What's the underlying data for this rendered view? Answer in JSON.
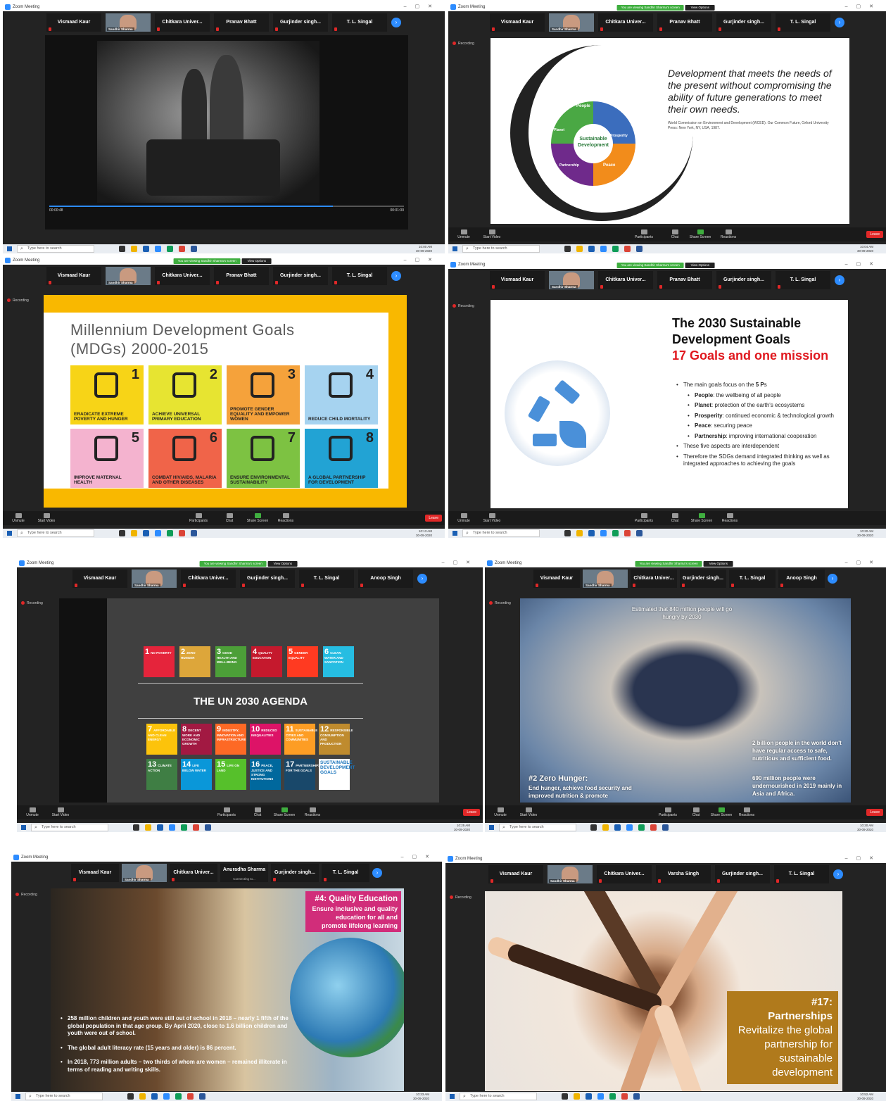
{
  "common": {
    "app_title": "Zoom Meeting",
    "banner": "You are viewing Sandhir Sharma's screen",
    "view_options": "View Options",
    "presenter_caption": "Sandhir Sharma",
    "search_placeholder": "Type here to search",
    "controls": [
      "Unmute",
      "Start Video",
      "Participants",
      "Chat",
      "Share Screen",
      "Reactions"
    ],
    "leave": "Leave",
    "recording": "Recording"
  },
  "panels": [
    {
      "tiles": [
        "Vismaad Kaur",
        "Chitkara Univer...",
        "Pranav Bhatt",
        "Gurjinder singh...",
        "T. L. Singal"
      ],
      "clock_time": "10:00 AM",
      "clock_date": "30-09-2020",
      "video_elapsed": "00:00:48",
      "video_total": "00:01:00"
    },
    {
      "tiles": [
        "Vismaad Kaur",
        "Chitkara Univer...",
        "Pranav Bhatt",
        "Gurjinder singh...",
        "T. L. Singal"
      ],
      "clock_time": "10:04 AM",
      "clock_date": "30-09-2020",
      "participants_count": "49"
    },
    {
      "tiles": [
        "Vismaad Kaur",
        "Chitkara Univer...",
        "Pranav Bhatt",
        "Gurjinder singh...",
        "T. L. Singal"
      ],
      "clock_time": "10:13 AM",
      "clock_date": "30-09-2020",
      "participants_count": "61"
    },
    {
      "tiles": [
        "Vismaad Kaur",
        "Chitkara Univer...",
        "Pranav Bhatt",
        "Gurjinder singh...",
        "T. L. Singal"
      ],
      "clock_time": "10:20 AM",
      "clock_date": "30-09-2020",
      "participants_count": "70"
    },
    {
      "tiles": [
        "Vismaad Kaur",
        "Chitkara Univer...",
        "Gurjinder singh...",
        "T. L. Singal",
        "Anoop Singh"
      ],
      "clock_time": "10:25 AM",
      "clock_date": "30-09-2020",
      "participants_count": "73"
    },
    {
      "tiles": [
        "Vismaad Kaur",
        "Chitkara Univer...",
        "Gurjinder singh...",
        "T. L. Singal",
        "Anoop Singh"
      ],
      "clock_time": "10:30 AM",
      "clock_date": "30-09-2020",
      "participants_count": "74"
    },
    {
      "tiles": [
        "Vismaad Kaur",
        "Chitkara Univer...",
        "Anuradha Sharma",
        "Gurjinder singh...",
        "T. L. Singal"
      ],
      "connecting": "Connecting to...",
      "clock_time": "10:33 AM",
      "clock_date": "30-09-2020"
    },
    {
      "tiles": [
        "Vismaad Kaur",
        "Chitkara Univer...",
        "Varsha Singh",
        "Gurjinder singh...",
        "T. L. Singal"
      ],
      "clock_time": "10:52 AM",
      "clock_date": "30-09-2020"
    }
  ],
  "slide_sd": {
    "quote": "Development that meets the needs of the present without compromising the ability of future generations to meet their own needs.",
    "citation": "World Commission on Environment and Development (WCED). Our Common Future, Oxford University Press: New York, NY, USA, 1987.",
    "core": "Sustainable Development",
    "segments": [
      "People",
      "Prosperity",
      "Peace",
      "Partnership",
      "Planet"
    ]
  },
  "slide_mdg": {
    "title_line1": "Millennium Development Goals",
    "title_line2": "(MDGs) 2000-2015",
    "goals": [
      {
        "n": "1",
        "label": "Eradicate extreme poverty and hunger",
        "color": "#f7d417"
      },
      {
        "n": "2",
        "label": "Achieve universal primary education",
        "color": "#e7e431"
      },
      {
        "n": "3",
        "label": "Promote gender equality and empower women",
        "color": "#f5a23b"
      },
      {
        "n": "4",
        "label": "Reduce child mortality",
        "color": "#a6d3f0"
      },
      {
        "n": "5",
        "label": "Improve maternal health",
        "color": "#f4b3cf"
      },
      {
        "n": "6",
        "label": "Combat HIV/AIDS, malaria and other diseases",
        "color": "#f06449"
      },
      {
        "n": "7",
        "label": "Ensure environmental sustainability",
        "color": "#7dc242"
      },
      {
        "n": "8",
        "label": "A global partnership for development",
        "color": "#22a3d4"
      }
    ]
  },
  "slide_sdg": {
    "title_line1": "The 2030 Sustainable",
    "title_line2": "Development Goals",
    "title_line3": "17 Goals and one mission",
    "b1_pre": "The main goals focus on the ",
    "b1_bold": "5 P",
    "b1_post": "s",
    "sub": [
      {
        "k": "People",
        "v": ": the wellbeing of all people"
      },
      {
        "k": "Planet",
        "v": ": protection of the earth's ecosystems"
      },
      {
        "k": "Prosperity",
        "v": ": continued economic & technological growth"
      },
      {
        "k": "Peace",
        "v": ": securing peace"
      },
      {
        "k": "Partnership",
        "v": ": improving international cooperation"
      }
    ],
    "b2": "These five aspects are interdependent",
    "b3": "Therefore the SDGs demand integrated thinking as well as integrated approaches to achieving the goals"
  },
  "slide_agenda": {
    "title": "THE UN 2030 AGENDA",
    "goals": [
      {
        "n": "1",
        "t": "NO POVERTY",
        "c": "#e5243b"
      },
      {
        "n": "2",
        "t": "ZERO HUNGER",
        "c": "#dda63a"
      },
      {
        "n": "3",
        "t": "GOOD HEALTH AND WELL-BEING",
        "c": "#4c9f38"
      },
      {
        "n": "4",
        "t": "QUALITY EDUCATION",
        "c": "#c5192d"
      },
      {
        "n": "5",
        "t": "GENDER EQUALITY",
        "c": "#ff3a21"
      },
      {
        "n": "6",
        "t": "CLEAN WATER AND SANITATION",
        "c": "#26bde2"
      },
      {
        "n": "7",
        "t": "AFFORDABLE AND CLEAN ENERGY",
        "c": "#fcc30b"
      },
      {
        "n": "8",
        "t": "DECENT WORK AND ECONOMIC GROWTH",
        "c": "#a21942"
      },
      {
        "n": "9",
        "t": "INDUSTRY, INNOVATION AND INFRASTRUCTURE",
        "c": "#fd6925"
      },
      {
        "n": "10",
        "t": "REDUCED INEQUALITIES",
        "c": "#dd1367"
      },
      {
        "n": "11",
        "t": "SUSTAINABLE CITIES AND COMMUNITIES",
        "c": "#fd9d24"
      },
      {
        "n": "12",
        "t": "RESPONSIBLE CONSUMPTION AND PRODUCTION",
        "c": "#bf8b2e"
      },
      {
        "n": "13",
        "t": "CLIMATE ACTION",
        "c": "#3f7e44"
      },
      {
        "n": "14",
        "t": "LIFE BELOW WATER",
        "c": "#0a97d9"
      },
      {
        "n": "15",
        "t": "LIFE ON LAND",
        "c": "#56c02b"
      },
      {
        "n": "16",
        "t": "PEACE, JUSTICE AND STRONG INSTITUTIONS",
        "c": "#00689d"
      },
      {
        "n": "17",
        "t": "PARTNERSHIPS FOR THE GOALS",
        "c": "#19486a"
      }
    ],
    "logo": "SUSTAINABLE DEVELOPMENT GOALS"
  },
  "slide_hunger": {
    "top": "Estimated that 840 million people will go hungry by 2030",
    "right1": "2 billion people in the world don't have regular access to safe, nutritious and sufficient food.",
    "right2": "690 million people were undernourished in 2019 mainly in Asia and Africa.",
    "heading": "#2 Zero Hunger:",
    "body": "End hunger, achieve food security and improved nutrition & promote"
  },
  "slide_edu": {
    "heading": "#4: Quality Education",
    "body": "Ensure inclusive and quality education for all and promote lifelong learning",
    "b1": "258 million children and youth were still out of school in 2018 – nearly 1 fifth of the global population in that age group. By April 2020, close to 1.6 billion children and youth were out of school.",
    "b2": "The global adult literacy rate (15 years and older) is 86 percent.",
    "b3": "In 2018, 773 million adults – two thirds of whom are women – remained illiterate in terms of reading and writing skills."
  },
  "slide_part": {
    "num": "#17:",
    "heading": "Partnerships",
    "body": "Revitalize the global partnership for sustainable development"
  }
}
